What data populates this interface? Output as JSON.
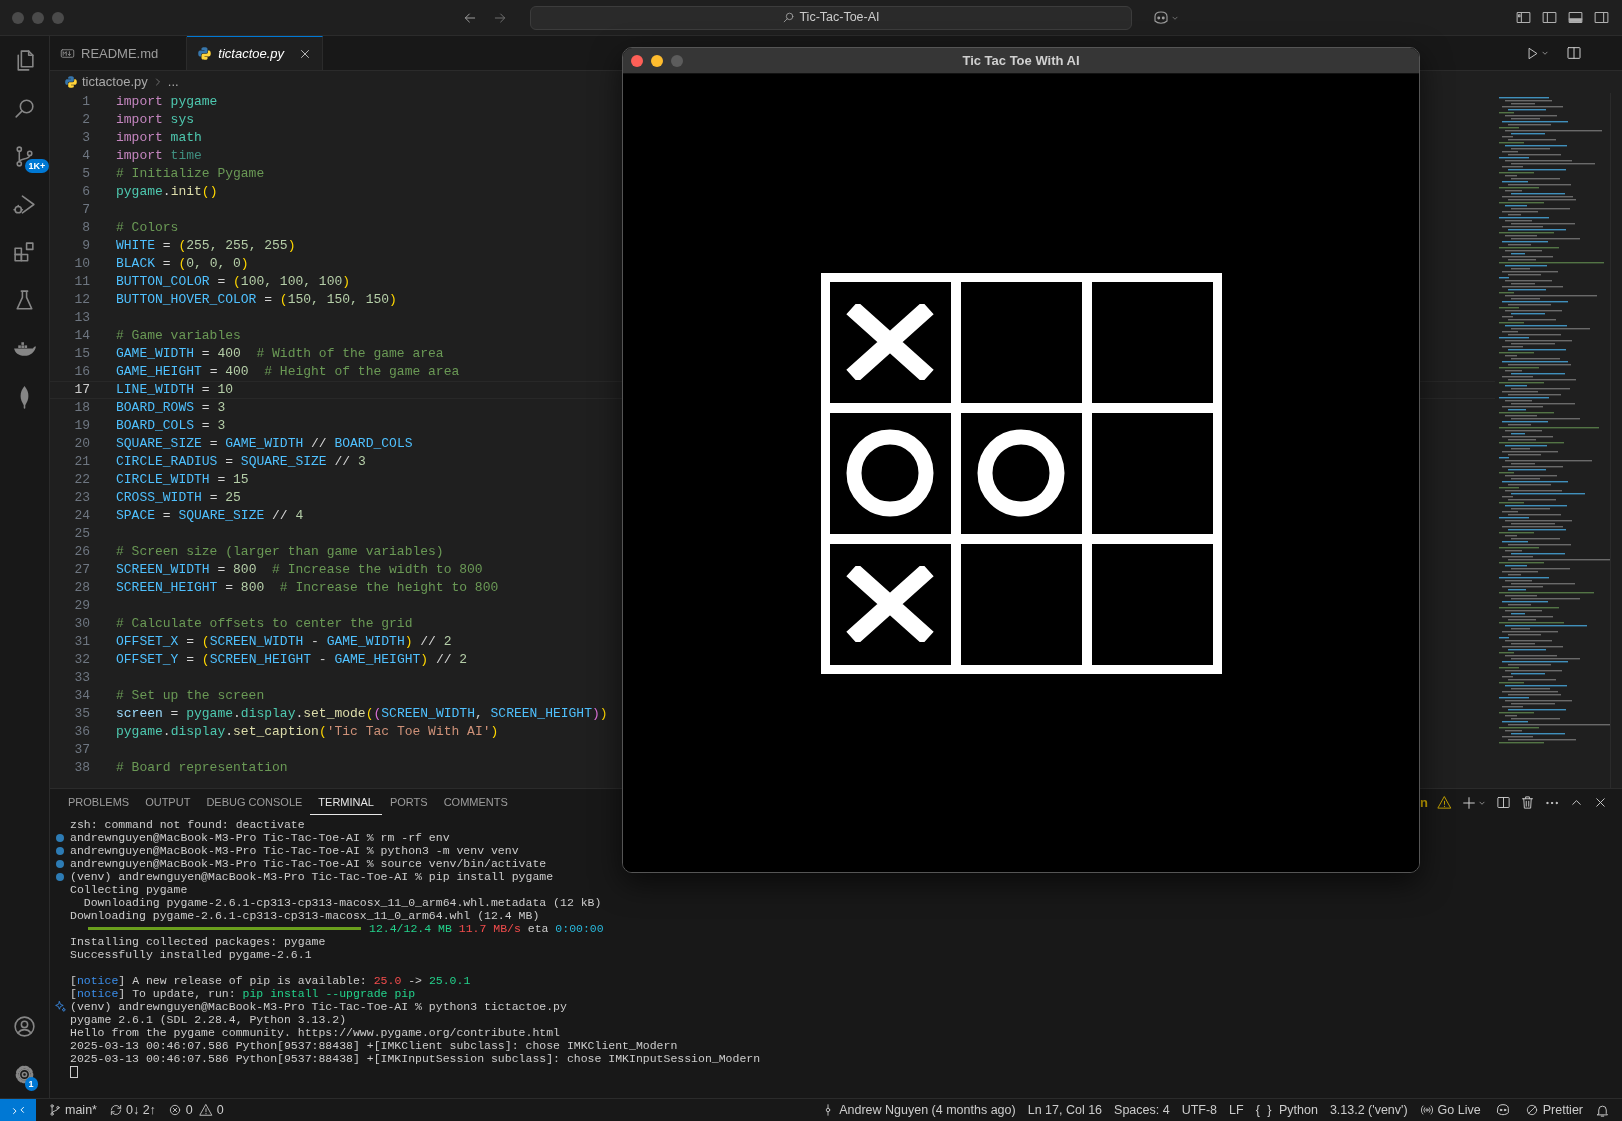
{
  "title_bar": {
    "search": "Tic-Tac-Toe-AI"
  },
  "activity_bar": {
    "top": [
      {
        "kind": "explorer"
      },
      {
        "kind": "search"
      },
      {
        "kind": "source-control",
        "badge": "1K+"
      },
      {
        "kind": "run-debug"
      },
      {
        "kind": "extensions"
      },
      {
        "kind": "testing"
      },
      {
        "kind": "docker"
      },
      {
        "kind": "leaf"
      }
    ],
    "bottom": [
      {
        "kind": "account"
      },
      {
        "kind": "settings",
        "badge": "1"
      }
    ]
  },
  "editor_tabs": [
    {
      "kind": "markdown",
      "label": "README.md",
      "selected": false
    },
    {
      "kind": "python",
      "label": "tictactoe.py",
      "selected": true
    }
  ],
  "breadcrumb": [
    "tictactoe.py",
    "..."
  ],
  "code_lines": [
    {
      "number": "1",
      "tokens": [
        {
          "text": "import ",
          "kind": "keyword"
        },
        {
          "text": "pygame",
          "kind": "module"
        }
      ]
    },
    {
      "number": "2",
      "tokens": [
        {
          "text": "import ",
          "kind": "keyword"
        },
        {
          "text": "sys",
          "kind": "module"
        }
      ]
    },
    {
      "number": "3",
      "tokens": [
        {
          "text": "import ",
          "kind": "keyword"
        },
        {
          "text": "math",
          "kind": "module"
        }
      ]
    },
    {
      "number": "4",
      "tokens": [
        {
          "text": "import ",
          "kind": "keyword"
        },
        {
          "text": "time",
          "kind": "unused"
        }
      ]
    },
    {
      "number": "5",
      "tokens": [
        {
          "text": "# Initialize Pygame",
          "kind": "comment"
        }
      ]
    },
    {
      "number": "6",
      "tokens": [
        {
          "text": "pygame",
          "kind": "module"
        },
        {
          "text": ".",
          "kind": "operator"
        },
        {
          "text": "init",
          "kind": "function"
        },
        {
          "text": "()",
          "kind": "paren"
        }
      ]
    },
    {
      "number": "7"
    },
    {
      "number": "8",
      "tokens": [
        {
          "text": "# Colors",
          "kind": "comment"
        }
      ]
    },
    {
      "number": "9",
      "tokens": [
        {
          "text": "WHITE",
          "kind": "constant"
        },
        {
          "text": " = ",
          "kind": "operator"
        },
        {
          "text": "(",
          "kind": "paren"
        },
        {
          "text": "255, 255, 255",
          "kind": "number"
        },
        {
          "text": ")",
          "kind": "paren"
        }
      ]
    },
    {
      "number": "10",
      "tokens": [
        {
          "text": "BLACK",
          "kind": "constant"
        },
        {
          "text": " = ",
          "kind": "operator"
        },
        {
          "text": "(",
          "kind": "paren"
        },
        {
          "text": "0, 0, 0",
          "kind": "number"
        },
        {
          "text": ")",
          "kind": "paren"
        }
      ]
    },
    {
      "number": "11",
      "tokens": [
        {
          "text": "BUTTON_COLOR",
          "kind": "constant"
        },
        {
          "text": " = ",
          "kind": "operator"
        },
        {
          "text": "(",
          "kind": "paren"
        },
        {
          "text": "100, 100, 100",
          "kind": "number"
        },
        {
          "text": ")",
          "kind": "paren"
        }
      ]
    },
    {
      "number": "12",
      "tokens": [
        {
          "text": "BUTTON_HOVER_COLOR",
          "kind": "constant"
        },
        {
          "text": " = ",
          "kind": "operator"
        },
        {
          "text": "(",
          "kind": "paren"
        },
        {
          "text": "150, 150, 150",
          "kind": "number"
        },
        {
          "text": ")",
          "kind": "paren"
        }
      ]
    },
    {
      "number": "13"
    },
    {
      "number": "14",
      "tokens": [
        {
          "text": "# Game variables",
          "kind": "comment"
        }
      ]
    },
    {
      "number": "15",
      "tokens": [
        {
          "text": "GAME_WIDTH",
          "kind": "constant"
        },
        {
          "text": " = ",
          "kind": "operator"
        },
        {
          "text": "400",
          "kind": "number"
        },
        {
          "text": "  # Width of the game area",
          "kind": "comment"
        }
      ]
    },
    {
      "number": "16",
      "tokens": [
        {
          "text": "GAME_HEIGHT",
          "kind": "constant"
        },
        {
          "text": " = ",
          "kind": "operator"
        },
        {
          "text": "400",
          "kind": "number"
        },
        {
          "text": "  # Height of the game area",
          "kind": "comment"
        }
      ]
    },
    {
      "number": "17",
      "current": true,
      "tokens": [
        {
          "text": "LINE_WIDTH",
          "kind": "constant"
        },
        {
          "text": " = ",
          "kind": "operator"
        },
        {
          "text": "10",
          "kind": "number"
        }
      ]
    },
    {
      "number": "18",
      "tokens": [
        {
          "text": "BOARD_ROWS",
          "kind": "constant"
        },
        {
          "text": " = ",
          "kind": "operator"
        },
        {
          "text": "3",
          "kind": "number"
        }
      ]
    },
    {
      "number": "19",
      "tokens": [
        {
          "text": "BOARD_COLS",
          "kind": "constant"
        },
        {
          "text": " = ",
          "kind": "operator"
        },
        {
          "text": "3",
          "kind": "number"
        }
      ]
    },
    {
      "number": "20",
      "tokens": [
        {
          "text": "SQUARE_SIZE",
          "kind": "constant"
        },
        {
          "text": " = ",
          "kind": "operator"
        },
        {
          "text": "GAME_WIDTH",
          "kind": "constant"
        },
        {
          "text": " // ",
          "kind": "operator"
        },
        {
          "text": "BOARD_COLS",
          "kind": "constant"
        }
      ]
    },
    {
      "number": "21",
      "tokens": [
        {
          "text": "CIRCLE_RADIUS",
          "kind": "constant"
        },
        {
          "text": " = ",
          "kind": "operator"
        },
        {
          "text": "SQUARE_SIZE",
          "kind": "constant"
        },
        {
          "text": " // ",
          "kind": "operator"
        },
        {
          "text": "3",
          "kind": "number"
        }
      ]
    },
    {
      "number": "22",
      "tokens": [
        {
          "text": "CIRCLE_WIDTH",
          "kind": "constant"
        },
        {
          "text": " = ",
          "kind": "operator"
        },
        {
          "text": "15",
          "kind": "number"
        }
      ]
    },
    {
      "number": "23",
      "tokens": [
        {
          "text": "CROSS_WIDTH",
          "kind": "constant"
        },
        {
          "text": " = ",
          "kind": "operator"
        },
        {
          "text": "25",
          "kind": "number"
        }
      ]
    },
    {
      "number": "24",
      "tokens": [
        {
          "text": "SPACE",
          "kind": "constant"
        },
        {
          "text": " = ",
          "kind": "operator"
        },
        {
          "text": "SQUARE_SIZE",
          "kind": "constant"
        },
        {
          "text": " // ",
          "kind": "operator"
        },
        {
          "text": "4",
          "kind": "number"
        }
      ]
    },
    {
      "number": "25"
    },
    {
      "number": "26",
      "tokens": [
        {
          "text": "# Screen size (larger than game variables)",
          "kind": "comment"
        }
      ]
    },
    {
      "number": "27",
      "tokens": [
        {
          "text": "SCREEN_WIDTH",
          "kind": "constant"
        },
        {
          "text": " = ",
          "kind": "operator"
        },
        {
          "text": "800",
          "kind": "number"
        },
        {
          "text": "  # Increase the width to 800",
          "kind": "comment"
        }
      ]
    },
    {
      "number": "28",
      "tokens": [
        {
          "text": "SCREEN_HEIGHT",
          "kind": "constant"
        },
        {
          "text": " = ",
          "kind": "operator"
        },
        {
          "text": "800",
          "kind": "number"
        },
        {
          "text": "  # Increase the height to 800",
          "kind": "comment"
        }
      ]
    },
    {
      "number": "29"
    },
    {
      "number": "30",
      "tokens": [
        {
          "text": "# Calculate offsets to center the grid",
          "kind": "comment"
        }
      ]
    },
    {
      "number": "31",
      "tokens": [
        {
          "text": "OFFSET_X",
          "kind": "constant"
        },
        {
          "text": " = ",
          "kind": "operator"
        },
        {
          "text": "(",
          "kind": "paren"
        },
        {
          "text": "SCREEN_WIDTH",
          "kind": "constant"
        },
        {
          "text": " - ",
          "kind": "operator"
        },
        {
          "text": "GAME_WIDTH",
          "kind": "constant"
        },
        {
          "text": ")",
          "kind": "paren"
        },
        {
          "text": " // ",
          "kind": "operator"
        },
        {
          "text": "2",
          "kind": "number"
        }
      ]
    },
    {
      "number": "32",
      "tokens": [
        {
          "text": "OFFSET_Y",
          "kind": "constant"
        },
        {
          "text": " = ",
          "kind": "operator"
        },
        {
          "text": "(",
          "kind": "paren"
        },
        {
          "text": "SCREEN_HEIGHT",
          "kind": "constant"
        },
        {
          "text": " - ",
          "kind": "operator"
        },
        {
          "text": "GAME_HEIGHT",
          "kind": "constant"
        },
        {
          "text": ")",
          "kind": "paren"
        },
        {
          "text": " // ",
          "kind": "operator"
        },
        {
          "text": "2",
          "kind": "number"
        }
      ]
    },
    {
      "number": "33"
    },
    {
      "number": "34",
      "tokens": [
        {
          "text": "# Set up the screen",
          "kind": "comment"
        }
      ]
    },
    {
      "number": "35",
      "tokens": [
        {
          "text": "screen",
          "kind": "variable"
        },
        {
          "text": " = ",
          "kind": "operator"
        },
        {
          "text": "pygame",
          "kind": "module"
        },
        {
          "text": ".",
          "kind": "operator"
        },
        {
          "text": "display",
          "kind": "module"
        },
        {
          "text": ".",
          "kind": "operator"
        },
        {
          "text": "set_mode",
          "kind": "function"
        },
        {
          "text": "(",
          "kind": "paren"
        },
        {
          "text": "(",
          "kind": "paren2"
        },
        {
          "text": "SCREEN_WIDTH",
          "kind": "constant"
        },
        {
          "text": ", ",
          "kind": "operator"
        },
        {
          "text": "SCREEN_HEIGHT",
          "kind": "constant"
        },
        {
          "text": ")",
          "kind": "paren2"
        },
        {
          "text": ")",
          "kind": "paren"
        }
      ]
    },
    {
      "number": "36",
      "tokens": [
        {
          "text": "pygame",
          "kind": "module"
        },
        {
          "text": ".",
          "kind": "operator"
        },
        {
          "text": "display",
          "kind": "module"
        },
        {
          "text": ".",
          "kind": "operator"
        },
        {
          "text": "set_caption",
          "kind": "function"
        },
        {
          "text": "(",
          "kind": "paren"
        },
        {
          "text": "'Tic Tac Toe With AI'",
          "kind": "string"
        },
        {
          "text": ")",
          "kind": "paren"
        }
      ]
    },
    {
      "number": "37"
    },
    {
      "number": "38",
      "tokens": [
        {
          "text": "# Board representation",
          "kind": "comment"
        }
      ]
    }
  ],
  "panel": {
    "tabs": [
      {
        "label": "PROBLEMS",
        "selected": false
      },
      {
        "label": "OUTPUT",
        "selected": false
      },
      {
        "label": "DEBUG CONSOLE",
        "selected": false
      },
      {
        "label": "TERMINAL",
        "selected": true
      },
      {
        "label": "PORTS",
        "selected": false
      },
      {
        "label": "COMMENTS",
        "selected": false
      }
    ],
    "terminal_name_fragment": "n",
    "terminal_lines": [
      {
        "kind": "text",
        "tokens": [
          {
            "text": "zsh: command not found: deactivate",
            "kind": "plain"
          }
        ]
      },
      {
        "kind": "command",
        "tokens": [
          {
            "text": "andrewnguyen@MacBook-M3-Pro Tic-Tac-Toe-AI % rm -rf env",
            "kind": "plain"
          }
        ]
      },
      {
        "kind": "command",
        "tokens": [
          {
            "text": "andrewnguyen@MacBook-M3-Pro Tic-Tac-Toe-AI % python3 -m venv venv",
            "kind": "plain"
          }
        ]
      },
      {
        "kind": "command",
        "tokens": [
          {
            "text": "andrewnguyen@MacBook-M3-Pro Tic-Tac-Toe-AI % source venv/bin/activate",
            "kind": "plain"
          }
        ]
      },
      {
        "kind": "command",
        "tokens": [
          {
            "text": "(venv) andrewnguyen@MacBook-M3-Pro Tic-Tac-Toe-AI % pip install pygame",
            "kind": "plain"
          }
        ]
      },
      {
        "kind": "text",
        "tokens": [
          {
            "text": "Collecting pygame",
            "kind": "plain"
          }
        ]
      },
      {
        "kind": "text",
        "tokens": [
          {
            "text": "  Downloading pygame-2.6.1-cp313-cp313-macosx_11_0_arm64.whl.metadata (12 kB)",
            "kind": "plain"
          }
        ]
      },
      {
        "kind": "text",
        "tokens": [
          {
            "text": "Downloading pygame-2.6.1-cp313-cp313-macosx_11_0_arm64.whl (12.4 MB)",
            "kind": "plain"
          }
        ]
      },
      {
        "kind": "progress",
        "level": 1.0,
        "tokens": [
          {
            "text": "12.4/12.4 MB",
            "kind": "green"
          },
          {
            "text": " 11.7 MB/s",
            "kind": "red"
          },
          {
            "text": " eta ",
            "kind": "plain"
          },
          {
            "text": "0:00:00",
            "kind": "cyan"
          }
        ]
      },
      {
        "kind": "text",
        "tokens": [
          {
            "text": "Installing collected packages: pygame",
            "kind": "plain"
          }
        ]
      },
      {
        "kind": "text",
        "tokens": [
          {
            "text": "Successfully installed pygame-2.6.1",
            "kind": "plain"
          }
        ]
      },
      {
        "kind": "blank"
      },
      {
        "kind": "text",
        "tokens": [
          {
            "text": "[",
            "kind": "plain"
          },
          {
            "text": "notice",
            "kind": "blue"
          },
          {
            "text": "] A new release of pip is available: ",
            "kind": "plain"
          },
          {
            "text": "25.0",
            "kind": "red"
          },
          {
            "text": " -> ",
            "kind": "plain"
          },
          {
            "text": "25.0.1",
            "kind": "green"
          }
        ]
      },
      {
        "kind": "text",
        "tokens": [
          {
            "text": "[",
            "kind": "plain"
          },
          {
            "text": "notice",
            "kind": "blue"
          },
          {
            "text": "] To update, run: ",
            "kind": "plain"
          },
          {
            "text": "pip install --upgrade pip",
            "kind": "green"
          }
        ]
      },
      {
        "kind": "suggested-command",
        "tokens": [
          {
            "text": "(venv) andrewnguyen@MacBook-M3-Pro Tic-Tac-Toe-AI % python3 tictactoe.py",
            "kind": "plain"
          }
        ]
      },
      {
        "kind": "text",
        "tokens": [
          {
            "text": "pygame 2.6.1 (SDL 2.28.4, Python 3.13.2)",
            "kind": "plain"
          }
        ]
      },
      {
        "kind": "text",
        "tokens": [
          {
            "text": "Hello from the pygame community. https://www.pygame.org/contribute.html",
            "kind": "plain"
          }
        ]
      },
      {
        "kind": "text",
        "tokens": [
          {
            "text": "2025-03-13 00:46:07.586 Python[9537:88438] +[IMKClient subclass]: chose IMKClient_Modern",
            "kind": "plain"
          }
        ]
      },
      {
        "kind": "text",
        "tokens": [
          {
            "text": "2025-03-13 00:46:07.586 Python[9537:88438] +[IMKInputSession subclass]: chose IMKInputSession_Modern",
            "kind": "plain"
          }
        ]
      },
      {
        "kind": "cursor"
      }
    ]
  },
  "game_window": {
    "title": "Tic Tac Toe With AI",
    "board": [
      {
        "kind": "cross"
      },
      {
        "kind": "empty"
      },
      {
        "kind": "empty"
      },
      {
        "kind": "circle"
      },
      {
        "kind": "circle"
      },
      {
        "kind": "empty"
      },
      {
        "kind": "cross"
      },
      {
        "kind": "empty"
      },
      {
        "kind": "empty"
      }
    ]
  },
  "status_bar": {
    "left": [
      {
        "kind": "remote"
      },
      {
        "kind": "branch",
        "text": "main*"
      },
      {
        "kind": "sync",
        "text": "0↓ 2↑"
      },
      {
        "kind": "problems",
        "errors": "0",
        "warnings": "0"
      }
    ],
    "right": [
      {
        "kind": "blame",
        "text": "Andrew Nguyen (4 months ago)"
      },
      {
        "kind": "text",
        "text": "Ln 17, Col 16"
      },
      {
        "kind": "text",
        "text": "Spaces: 4"
      },
      {
        "kind": "text",
        "text": "UTF-8"
      },
      {
        "kind": "text",
        "text": "LF"
      },
      {
        "kind": "language",
        "icon": "{ }",
        "text": "Python"
      },
      {
        "kind": "text",
        "text": "3.13.2 ('venv')"
      },
      {
        "kind": "golive",
        "text": "Go Live"
      },
      {
        "kind": "copilot"
      },
      {
        "kind": "prettier",
        "text": "Prettier"
      },
      {
        "kind": "bell"
      }
    ]
  }
}
